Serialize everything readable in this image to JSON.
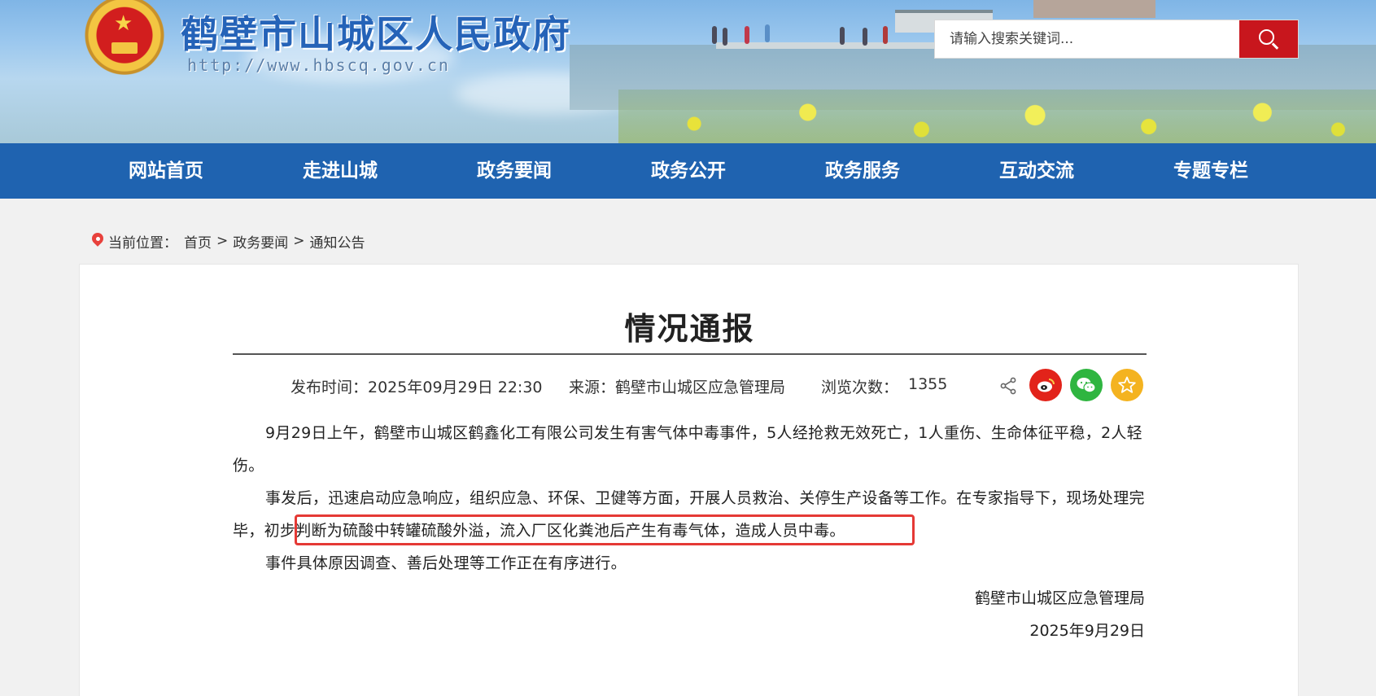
{
  "header": {
    "site_title": "鹤壁市山城区人民政府",
    "site_url": "http://www.hbscq.gov.cn",
    "search_placeholder": "请输入搜索关键词..."
  },
  "nav": {
    "items": [
      "网站首页",
      "走进山城",
      "政务要闻",
      "政务公开",
      "政务服务",
      "互动交流",
      "专题专栏"
    ]
  },
  "breadcrumb": {
    "label": "当前位置：",
    "items": [
      "首页",
      "政务要闻",
      "通知公告"
    ],
    "separator": ">"
  },
  "article": {
    "title": "情况通报",
    "publish_time": "发布时间：2025年09月29日 22:30",
    "source": "来源：鹤壁市山城区应急管理局",
    "views_label": "浏览次数：",
    "views_value": "1355",
    "paragraphs": [
      "9月29日上午，鹤壁市山城区鹤鑫化工有限公司发生有害气体中毒事件，5人经抢救无效死亡，1人重伤、生命体征平稳，2人轻伤。",
      "事发后，迅速启动应急响应，组织应急、环保、卫健等方面，开展人员救治、关停生产设备等工作。在专家指导下，现场处理完毕，初步判断为硫酸中转罐硫酸外溢，流入厂区化粪池后产生有毒气体，造成人员中毒。",
      "事件具体原因调查、善后处理等工作正在有序进行。"
    ],
    "signature_org": "鹤壁市山城区应急管理局",
    "signature_date": "2025年9月29日"
  },
  "share_icons": [
    "share-icon",
    "weibo-icon",
    "wechat-icon",
    "favorite-star-icon"
  ],
  "colors": {
    "nav_bg": "#1f63b0",
    "search_button": "#c8161d",
    "highlight_box": "#e53935",
    "weibo": "#e2231a",
    "wechat": "#2fb540",
    "favorite": "#f4b320"
  }
}
